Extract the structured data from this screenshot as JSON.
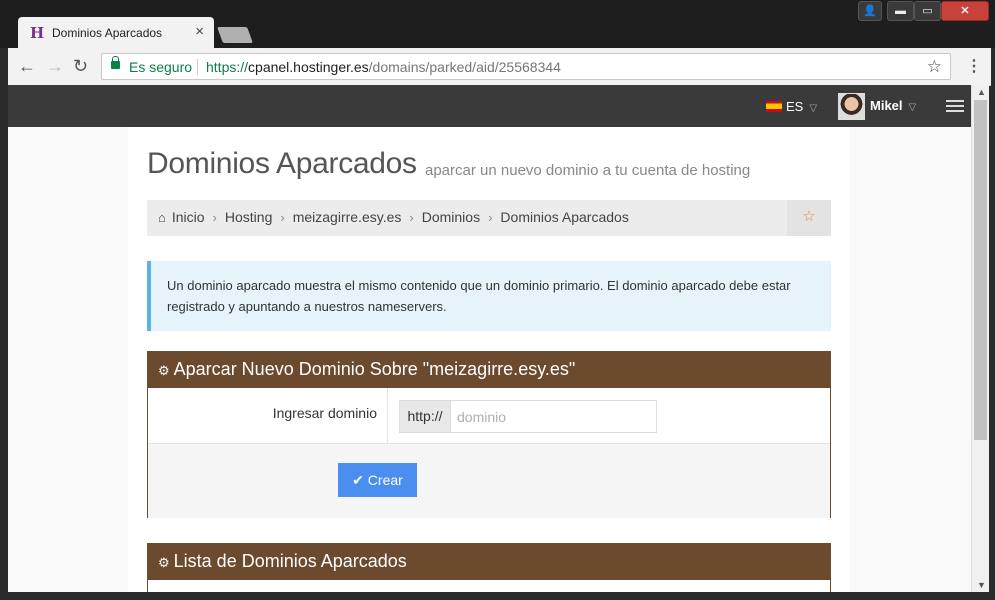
{
  "browser": {
    "tab_title": "Dominios Aparcados",
    "tab_favicon": "H",
    "tab_close": "×",
    "security_label": "Es seguro",
    "url_scheme": "https://",
    "url_host": "cpanel.hostinger.es",
    "url_path": "/domains/parked/aid/25568344",
    "bookmark_icon": "☆",
    "menu_icon": "⋮",
    "back_icon": "←",
    "forward_icon": "→",
    "reload_icon": "↻",
    "window_controls": {
      "user": "👤",
      "minimize": "▬",
      "maximize": "▭",
      "close": "✕"
    }
  },
  "appbar": {
    "language": "ES",
    "user_name": "Mikel",
    "caret": "▽"
  },
  "page": {
    "title": "Dominios Aparcados",
    "subtitle": "aparcar un nuevo dominio a tu cuenta de hosting",
    "breadcrumb": [
      "Inicio",
      "Hosting",
      "meizagirre.esy.es",
      "Dominios",
      "Dominios Aparcados"
    ],
    "breadcrumb_separator": "›",
    "home_icon": "⌂",
    "favorite_icon": "☆",
    "alert_text": "Un dominio aparcado muestra el mismo contenido que un dominio primario. El dominio aparcado debe estar registrado y apuntando a nuestros nameservers.",
    "gear_icon": "⚙",
    "panel_new": {
      "title": "Aparcar Nuevo Dominio Sobre \"meizagirre.esy.es\"",
      "field_label": "Ingresar dominio",
      "prefix": "http://",
      "placeholder": "dominio",
      "button_label": "✔ Crear"
    },
    "panel_list": {
      "title": "Lista de Dominios Aparcados"
    }
  },
  "colors": {
    "panel_header": "#6b4a2e",
    "primary_button": "#4a8ef0",
    "alert_bg": "#e6f3fa",
    "secure_green": "#0b8043"
  }
}
